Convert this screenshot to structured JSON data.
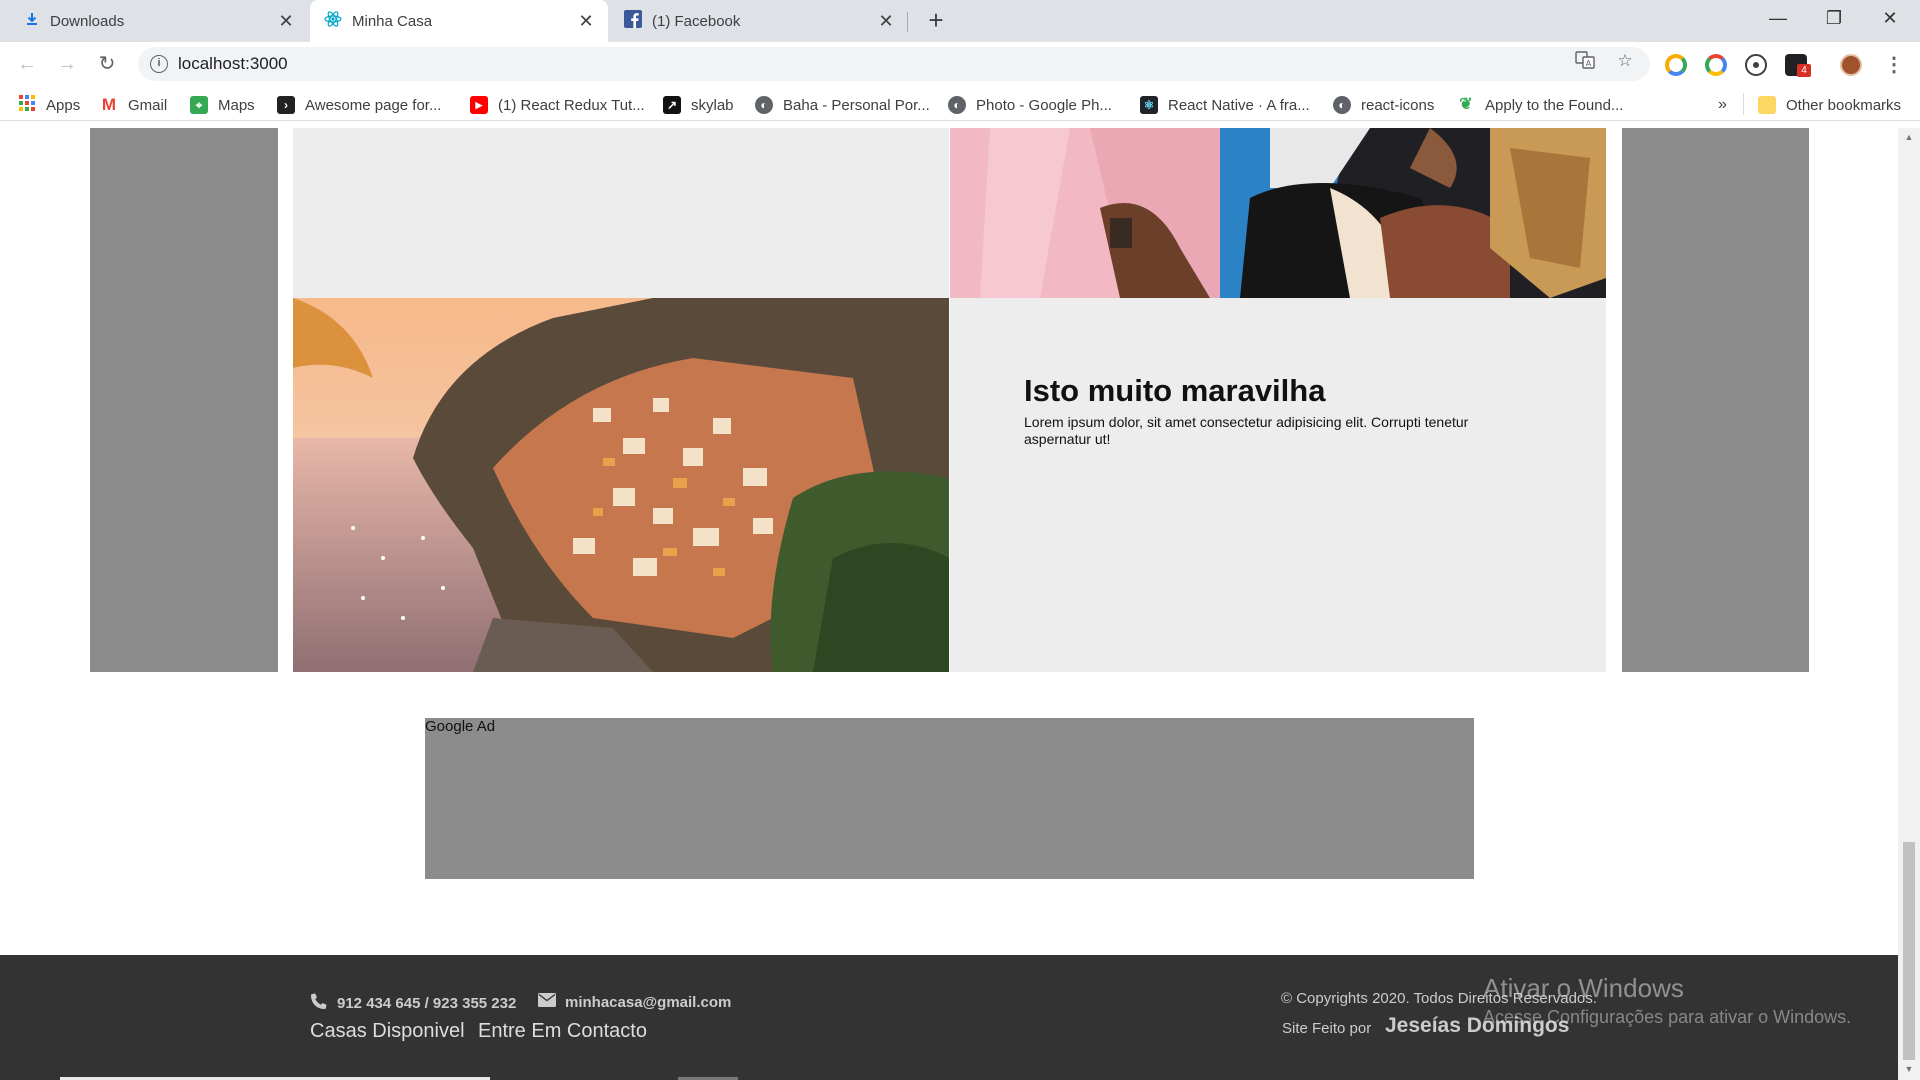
{
  "browser": {
    "tabs": [
      {
        "title": "Downloads",
        "icon": "download-icon",
        "active": false
      },
      {
        "title": "Minha Casa",
        "icon": "react-icon",
        "active": true
      },
      {
        "title": "(1) Facebook",
        "icon": "facebook-icon",
        "active": false
      }
    ],
    "url": "localhost:3000",
    "bookmarks": [
      {
        "label": "Apps",
        "icon": "apps-grid-icon"
      },
      {
        "label": "Gmail",
        "icon": "gmail-icon"
      },
      {
        "label": "Maps",
        "icon": "maps-icon"
      },
      {
        "label": "Awesome page for...",
        "icon": "bookmark-site-icon"
      },
      {
        "label": "(1) React Redux Tut...",
        "icon": "youtube-icon"
      },
      {
        "label": "skylab",
        "icon": "skylab-icon"
      },
      {
        "label": "Baha - Personal Por...",
        "icon": "globe-icon"
      },
      {
        "label": "Photo - Google Ph...",
        "icon": "globe-icon"
      },
      {
        "label": "React Native · A fra...",
        "icon": "react-native-icon"
      },
      {
        "label": "react-icons",
        "icon": "globe-icon"
      },
      {
        "label": "Apply to the Found...",
        "icon": "leaf-icon"
      }
    ],
    "bookmarks_overflow": "»",
    "other_bookmarks": "Other bookmarks",
    "extension_badge": "4"
  },
  "page": {
    "feature": {
      "title": "Isto muito maravilha",
      "text": "Lorem ipsum dolor, sit amet consectetur adipisicing elit. Corrupti tenetur aspernatur ut!"
    },
    "ad_label": "Google Ad",
    "footer": {
      "phone": "912 434 645 / 923 355 232",
      "email": "minhacasa@gmail.com",
      "links": [
        "Casas Disponivel",
        "Entre Em Contacto"
      ],
      "copyright": "© Copyrights 2020. Todos Direitos Reservados.",
      "made_by_label": "Site Feito por",
      "author": "Jeseías Domingos"
    }
  },
  "watermark": {
    "title": "Ativar o Windows",
    "subtitle": "Acesse Configurações para ativar o Windows."
  },
  "colors": {
    "chrome_bg": "#dee1e6",
    "side_column": "#8c8c8c",
    "card_bg": "#ededed",
    "footer_bg": "#333333"
  }
}
